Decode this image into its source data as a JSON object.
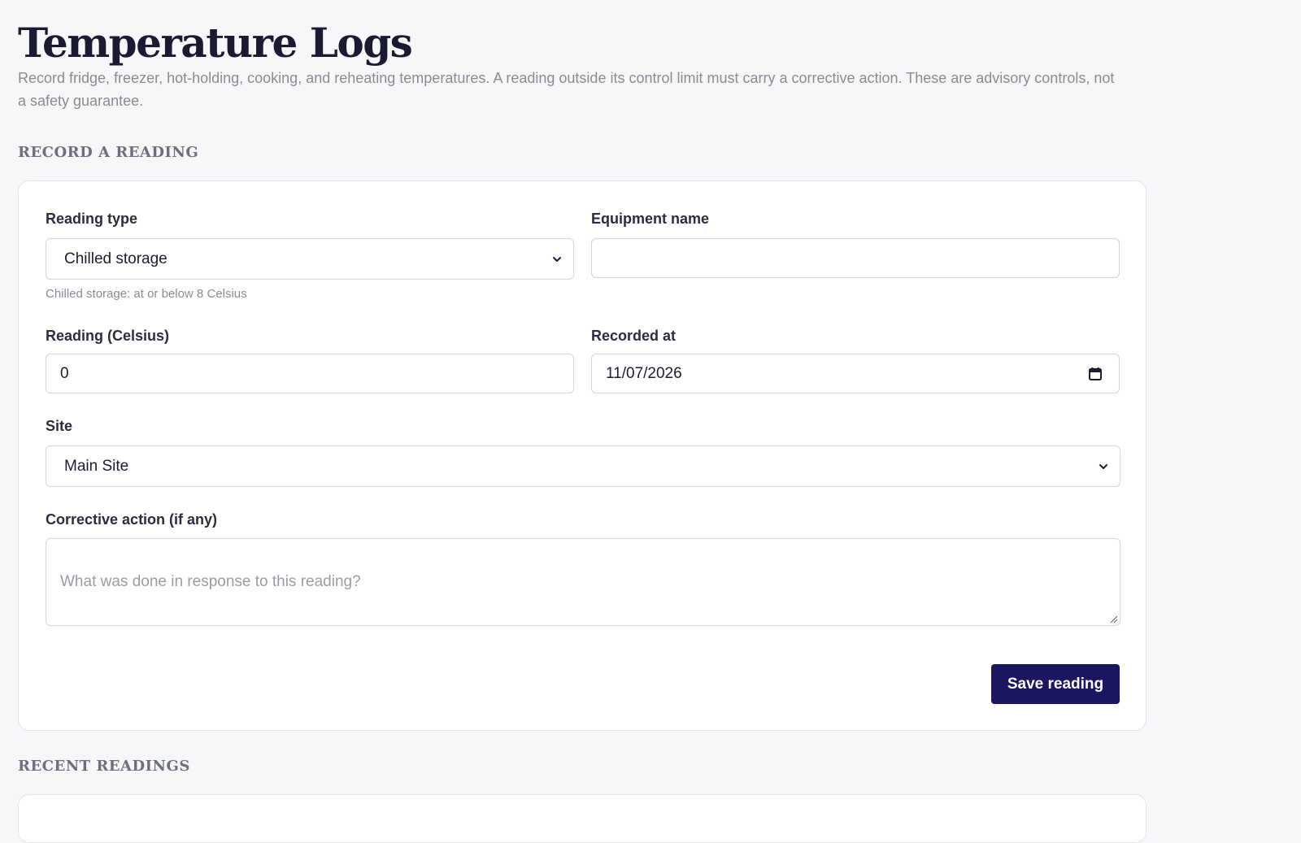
{
  "header": {
    "title": "Temperature Logs",
    "description": "Record fridge, freezer, hot-holding, cooking, and reheating temperatures. A reading outside its control limit must carry a corrective action. These are advisory controls, not a safety guarantee."
  },
  "record_section": {
    "heading": "RECORD A READING",
    "reading_type": {
      "label": "Reading type",
      "value": "Chilled storage",
      "hint": "Chilled storage: at or below 8 Celsius"
    },
    "equipment_name": {
      "label": "Equipment name",
      "value": ""
    },
    "reading_celsius": {
      "label": "Reading (Celsius)",
      "value": "0"
    },
    "recorded_at": {
      "label": "Recorded at",
      "value": "11/07/2026"
    },
    "site": {
      "label": "Site",
      "value": "Main Site"
    },
    "corrective_action": {
      "label": "Corrective action (if any)",
      "placeholder": "What was done in response to this reading?"
    },
    "save_button": "Save reading"
  },
  "recent_section": {
    "heading": "RECENT READINGS"
  },
  "icons": {
    "select_chevron": "chevron-down-icon",
    "date_picker": "calendar-icon",
    "textarea_resize": "resize-grip-icon"
  },
  "colors": {
    "primary_button": "#1a1760",
    "page_background": "#f7f7f9",
    "card_border": "#e3e4ea"
  }
}
